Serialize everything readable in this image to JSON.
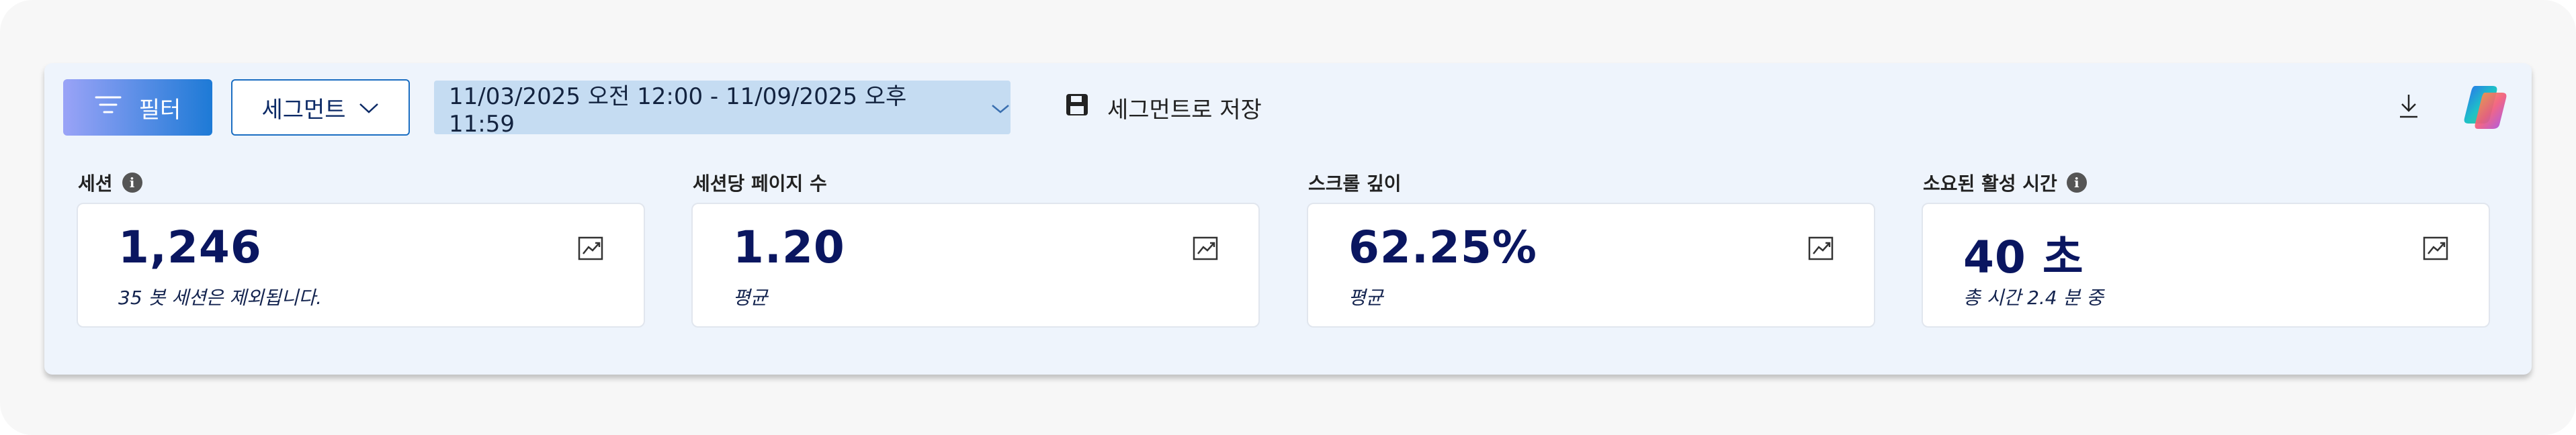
{
  "toolbar": {
    "filter_label": "필터",
    "segment_label": "세그먼트",
    "date_range": "11/03/2025 오전 12:00 - 11/09/2025 오후 11:59",
    "save_segment_label": "세그먼트로 저장"
  },
  "metrics": [
    {
      "title": "세션",
      "value": "1,246",
      "sub": "35 봇 세션은 제외됩니다.",
      "has_info": true
    },
    {
      "title": "세션당 페이지 수",
      "value": "1.20",
      "sub": "평균",
      "has_info": false
    },
    {
      "title": "스크롤 깊이",
      "value": "62.25%",
      "sub": "평균",
      "has_info": false
    },
    {
      "title": "소요된 활성 시간",
      "value": "40 초",
      "sub": "총 시간 2.4 분 중",
      "has_info": true
    }
  ],
  "icons": {
    "filter": "filter-lines-icon",
    "segment_dropdown": "chevron-down-icon",
    "date_dropdown": "chevron-down-icon",
    "save": "floppy-disk-icon",
    "download": "download-icon",
    "copilot": "copilot-logo-icon",
    "info": "info-icon",
    "trend": "trend-chart-icon"
  },
  "colors": {
    "panel_bg": "#eef4fc",
    "filter_gradient_start": "#9aa3f7",
    "filter_gradient_end": "#1d7ad6",
    "segment_border": "#1b6ec2",
    "date_bg": "#c5dcf2",
    "metric_value": "#0a1660"
  }
}
